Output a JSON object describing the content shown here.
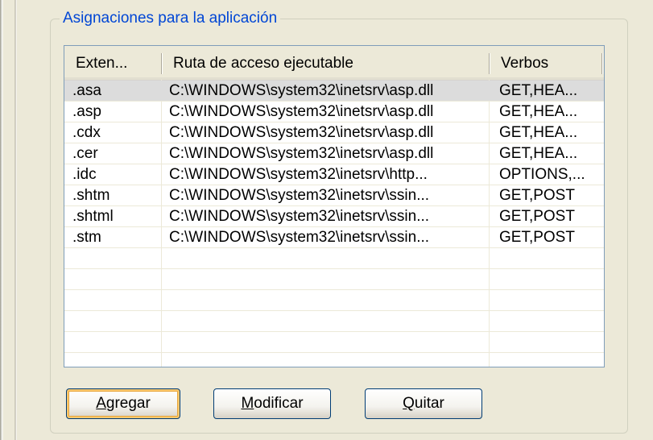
{
  "group": {
    "title": "Asignaciones para la aplicación"
  },
  "list": {
    "columns": [
      "Exten...",
      "Ruta de acceso ejecutable",
      "Verbos"
    ],
    "rows": [
      {
        "ext": ".asa",
        "path": "C:\\WINDOWS\\system32\\inetsrv\\asp.dll",
        "verbs": "GET,HEA...",
        "selected": true
      },
      {
        "ext": ".asp",
        "path": "C:\\WINDOWS\\system32\\inetsrv\\asp.dll",
        "verbs": "GET,HEA..."
      },
      {
        "ext": ".cdx",
        "path": "C:\\WINDOWS\\system32\\inetsrv\\asp.dll",
        "verbs": "GET,HEA..."
      },
      {
        "ext": ".cer",
        "path": "C:\\WINDOWS\\system32\\inetsrv\\asp.dll",
        "verbs": "GET,HEA..."
      },
      {
        "ext": ".idc",
        "path": "C:\\WINDOWS\\system32\\inetsrv\\http...",
        "verbs": "OPTIONS,..."
      },
      {
        "ext": ".shtm",
        "path": "C:\\WINDOWS\\system32\\inetsrv\\ssin...",
        "verbs": "GET,POST"
      },
      {
        "ext": ".shtml",
        "path": "C:\\WINDOWS\\system32\\inetsrv\\ssin...",
        "verbs": "GET,POST"
      },
      {
        "ext": ".stm",
        "path": "C:\\WINDOWS\\system32\\inetsrv\\ssin...",
        "verbs": "GET,POST"
      }
    ],
    "empty_rows": 5
  },
  "buttons": {
    "add": {
      "mnemonic": "A",
      "rest": "gregar"
    },
    "modify": {
      "mnemonic": "M",
      "rest": "odificar"
    },
    "remove": {
      "mnemonic": "Q",
      "rest": "uitar"
    }
  },
  "colors": {
    "group_title": "#0046d5",
    "selection": "#dcdcdc",
    "dialog_bg": "#ece9d8",
    "default_button_ring": "#f9c86e"
  }
}
